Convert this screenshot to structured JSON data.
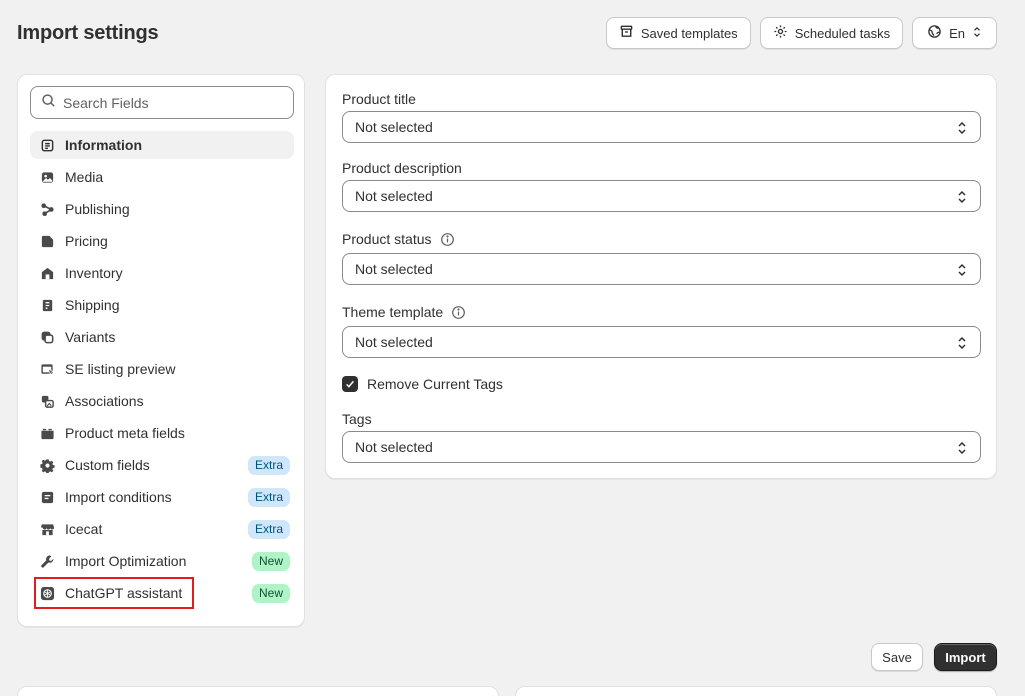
{
  "header": {
    "title": "Import settings",
    "saved_templates": "Saved templates",
    "scheduled_tasks": "Scheduled tasks",
    "language": "En"
  },
  "sidebar": {
    "search_placeholder": "Search Fields",
    "items": [
      {
        "label": "Information",
        "icon": "list-icon"
      },
      {
        "label": "Media",
        "icon": "image-icon"
      },
      {
        "label": "Publishing",
        "icon": "share-icon"
      },
      {
        "label": "Pricing",
        "icon": "tag-icon"
      },
      {
        "label": "Inventory",
        "icon": "warehouse-icon"
      },
      {
        "label": "Shipping",
        "icon": "box-icon"
      },
      {
        "label": "Variants",
        "icon": "variants-icon"
      },
      {
        "label": "SE listing preview",
        "icon": "preview-icon"
      },
      {
        "label": "Associations",
        "icon": "link-icon"
      },
      {
        "label": "Product meta fields",
        "icon": "folder-icon"
      },
      {
        "label": "Custom fields",
        "icon": "gear-icon",
        "badge": "Extra"
      },
      {
        "label": "Import conditions",
        "icon": "note-icon",
        "badge": "Extra"
      },
      {
        "label": "Icecat",
        "icon": "store-icon",
        "badge": "Extra"
      },
      {
        "label": "Import Optimization",
        "icon": "wrench-icon",
        "badge": "New"
      },
      {
        "label": "ChatGPT assistant",
        "icon": "chatgpt-icon",
        "badge": "New"
      }
    ]
  },
  "main": {
    "fields": [
      {
        "label": "Product title",
        "value": "Not selected",
        "info": false
      },
      {
        "label": "Product description",
        "value": "Not selected",
        "info": false
      },
      {
        "label": "Product status",
        "value": "Not selected",
        "info": true
      },
      {
        "label": "Theme template",
        "value": "Not selected",
        "info": true
      }
    ],
    "remove_tags_label": "Remove Current Tags",
    "remove_tags_checked": true,
    "tags": {
      "label": "Tags",
      "value": "Not selected"
    }
  },
  "footer": {
    "save": "Save",
    "import": "Import"
  },
  "colors": {
    "background": "#f1f1f1",
    "primary_button": "#303030",
    "badge_extra": "#cfe6fb",
    "badge_new": "#aff3c6",
    "highlight": "#e01e1e"
  }
}
